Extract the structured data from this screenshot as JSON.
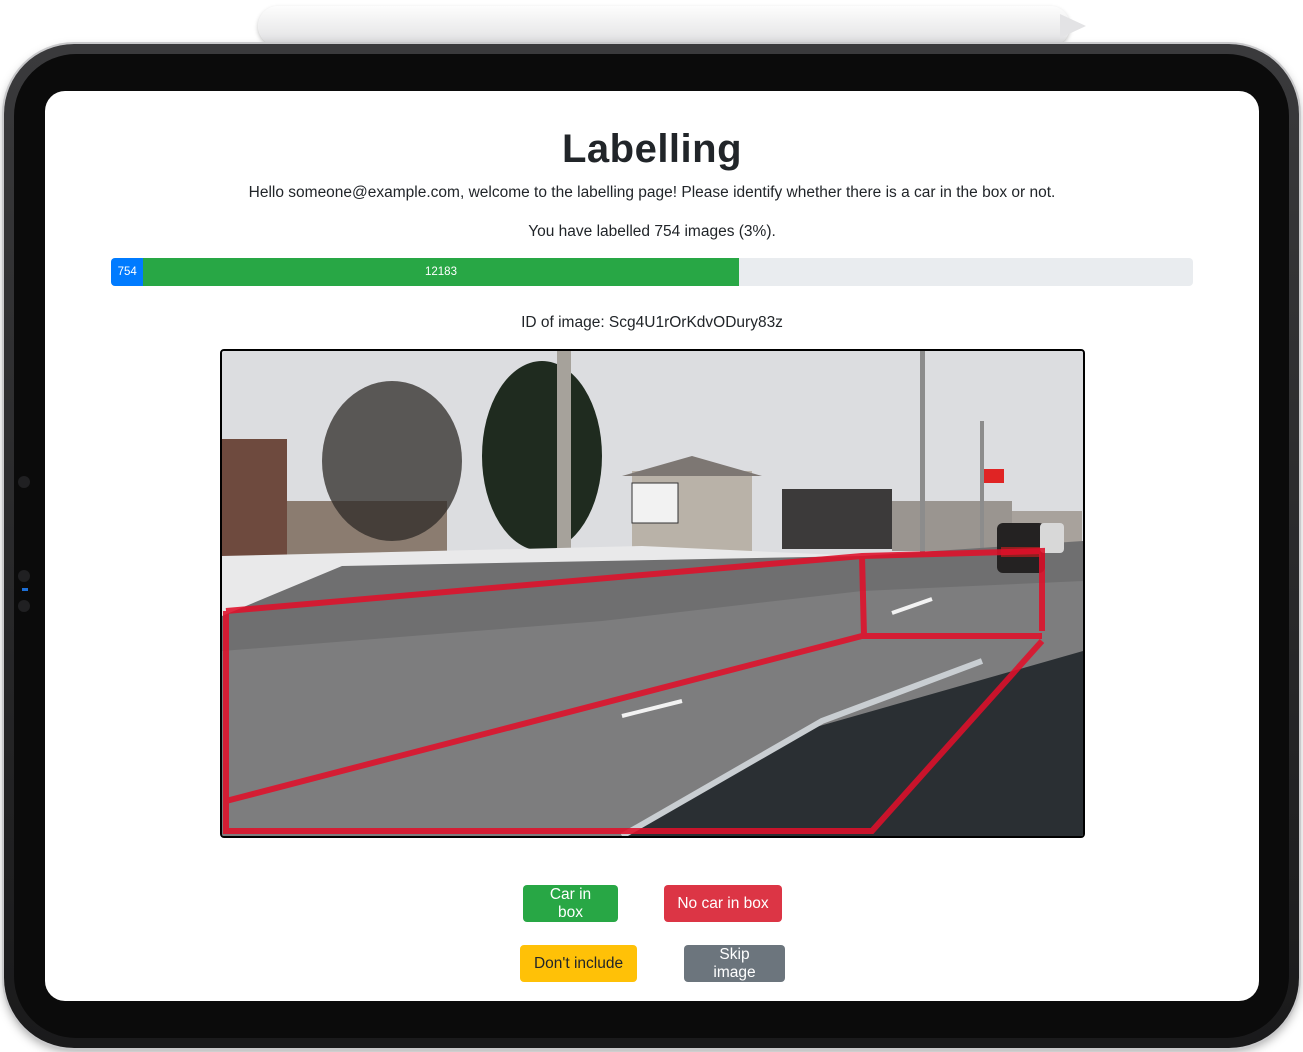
{
  "page": {
    "title": "Labelling",
    "intro": "Hello someone@example.com, welcome to the labelling page! Please identify whether there is a car in the box or not.",
    "count_text": "You have labelled 754 images (3%).",
    "image_id_text": "ID of image: Scg4U1rOrKdvODury83z"
  },
  "progress": {
    "segments": [
      {
        "label": "754",
        "fraction": 0.03,
        "color": "#007bff"
      },
      {
        "label": "12183",
        "fraction": 0.55,
        "color": "#28a745"
      }
    ]
  },
  "photo": {
    "description_icon": "street-scene-image",
    "overlay_color": "#e0102a"
  },
  "buttons": {
    "car_in_box": "Car in box",
    "no_car_in_box": "No car in box",
    "dont_include": "Don't include",
    "skip_image": "Skip image"
  },
  "colors": {
    "success": "#28a745",
    "danger": "#dc3545",
    "warning": "#ffc107",
    "secondary": "#6c757d",
    "primary": "#007bff"
  }
}
